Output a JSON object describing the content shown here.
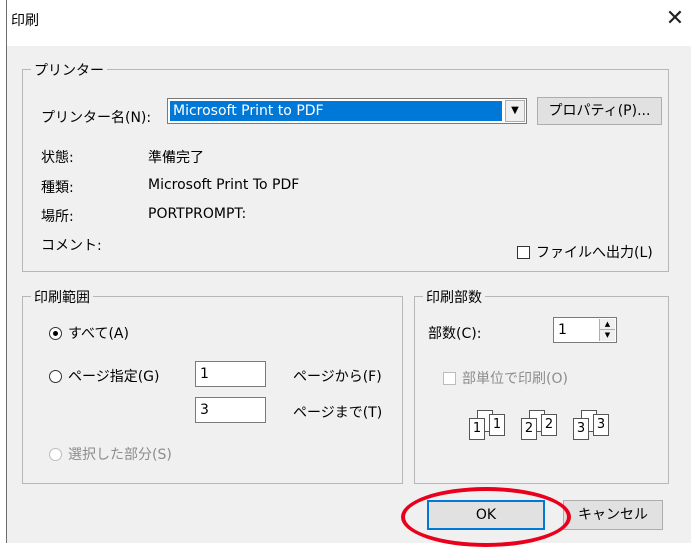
{
  "dialog": {
    "title": "印刷",
    "close_glyph": "✕"
  },
  "printer": {
    "legend": "プリンター",
    "name_label": "プリンター名(N):",
    "selected": "Microsoft Print to PDF",
    "dropdown_glyph": "▼",
    "properties_button": "プロパティ(P)...",
    "status_label": "状態:",
    "status_value": "準備完了",
    "type_label": "種類:",
    "type_value": "Microsoft Print To PDF",
    "where_label": "場所:",
    "where_value": "PORTPROMPT:",
    "comment_label": "コメント:",
    "print_to_file_label": "ファイルへ出力(L)"
  },
  "range": {
    "legend": "印刷範囲",
    "all_label": "すべて(A)",
    "pages_label": "ページ指定(G)",
    "from_value": "1",
    "from_label": "ページから(F)",
    "to_value": "3",
    "to_label": "ページまで(T)",
    "selection_label": "選択した部分(S)"
  },
  "copies": {
    "legend": "印刷部数",
    "count_label": "部数(C):",
    "count_value": "1",
    "spin_up": "▲",
    "spin_down": "▼",
    "collate_label": "部単位で印刷(O)",
    "collate_pages": [
      "1",
      "1",
      "2",
      "2",
      "3",
      "3"
    ]
  },
  "buttons": {
    "ok": "OK",
    "cancel": "キャンセル"
  },
  "annotation": {
    "circle_color": "#e8001c"
  }
}
